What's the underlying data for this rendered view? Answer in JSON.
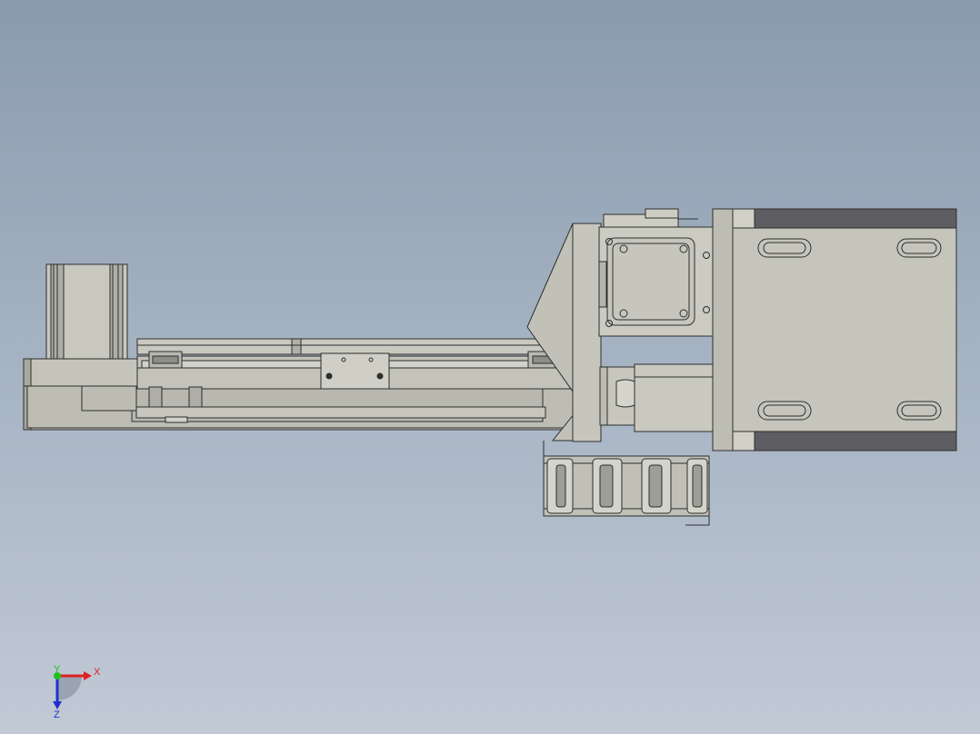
{
  "viewport": {
    "background_top": "#8a9bae",
    "background_bottom": "#c1c9d5",
    "part_fill": "#c4c4bb",
    "part_shade": "#a9a9a0",
    "edge_color": "#2e2e2e",
    "dark_fill": "#5e5e62"
  },
  "triad": {
    "x_label": "X",
    "y_label": "Y",
    "z_label": "Z",
    "x_color": "#e02020",
    "y_color": "#20c020",
    "z_color": "#2030d0"
  }
}
